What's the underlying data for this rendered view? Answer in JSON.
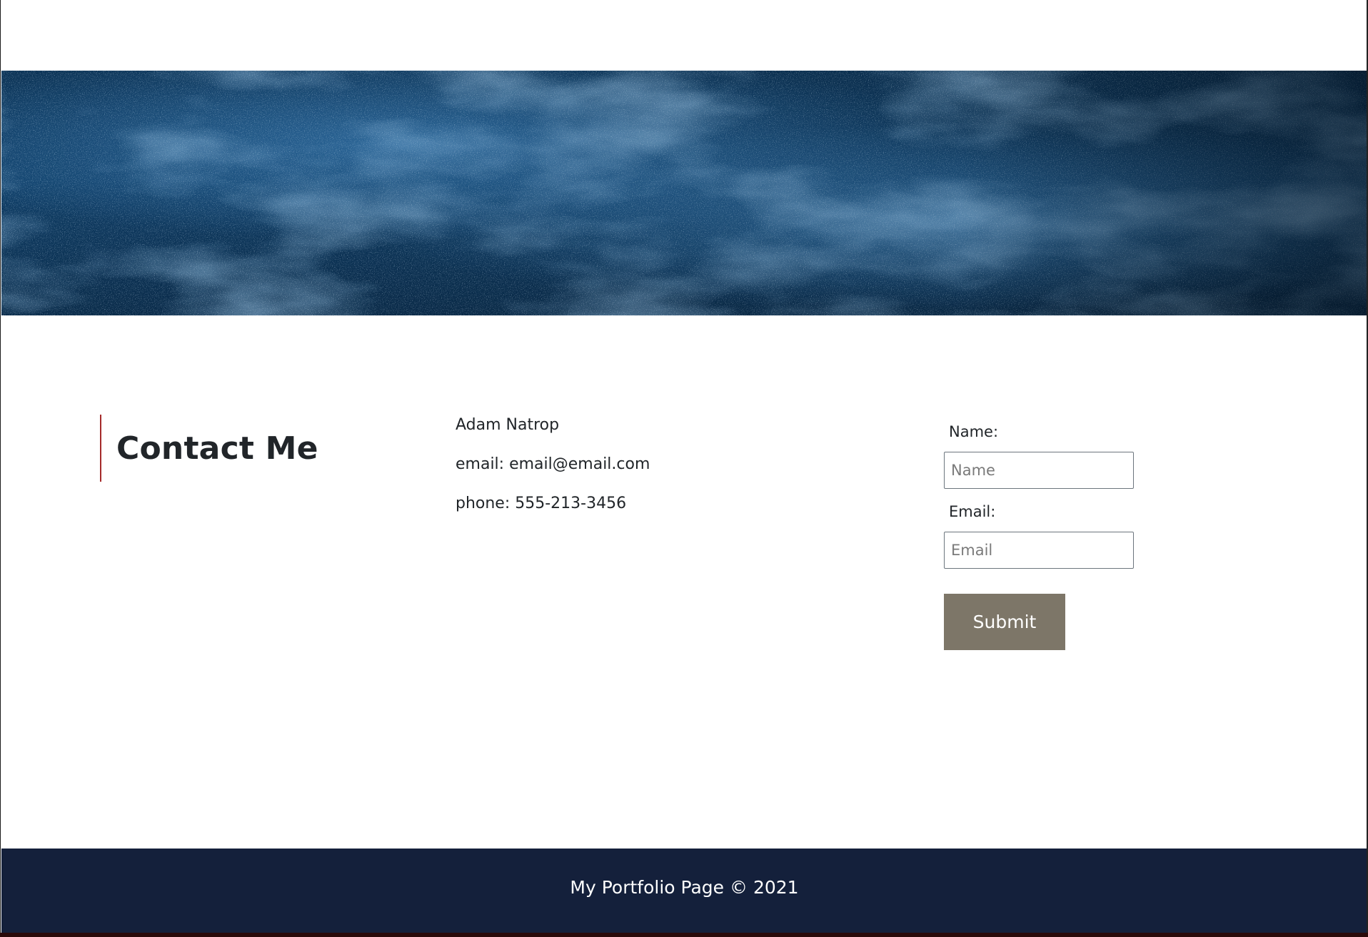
{
  "contact": {
    "heading": "Contact Me",
    "name": "Adam Natrop",
    "email": "email: email@email.com",
    "phone": "phone: 555-213-3456"
  },
  "form": {
    "name_label": "Name:",
    "name_placeholder": "Name",
    "email_label": "Email:",
    "email_placeholder": "Email",
    "submit_label": "Submit"
  },
  "footer": {
    "text": "My Portfolio Page © 2021"
  },
  "colors": {
    "accent_border": "#a52a2a",
    "button": "#7d7668",
    "footer_bg": "#14203b",
    "hero_base": "#0c3457"
  }
}
